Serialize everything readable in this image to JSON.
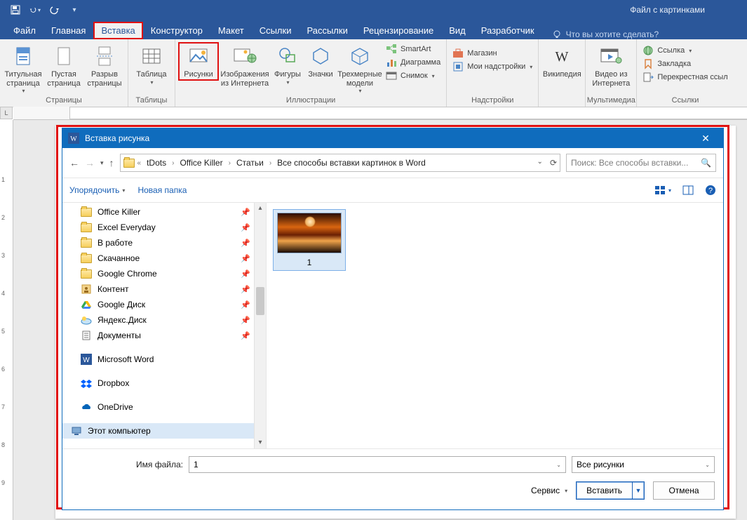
{
  "title": "Файл с картинками",
  "qat": {
    "save": "save",
    "undo": "undo",
    "redo": "redo"
  },
  "menu": {
    "tabs": [
      "Файл",
      "Главная",
      "Вставка",
      "Конструктор",
      "Макет",
      "Ссылки",
      "Рассылки",
      "Рецензирование",
      "Вид",
      "Разработчик"
    ],
    "active_index": 2,
    "tellme": "Что вы хотите сделать?"
  },
  "ribbon": {
    "pages": {
      "label": "Страницы",
      "cover": "Титульная страница",
      "blank": "Пустая страница",
      "break": "Разрыв страницы"
    },
    "tables": {
      "label": "Таблицы",
      "table": "Таблица"
    },
    "illustr": {
      "label": "Иллюстрации",
      "pictures": "Рисунки",
      "online": "Изображения из Интернета",
      "shapes": "Фигуры",
      "icons": "Значки",
      "models": "Трехмерные модели",
      "smartart": "SmartArt",
      "chart": "Диаграмма",
      "screenshot": "Снимок"
    },
    "addins": {
      "label": "Надстройки",
      "store": "Магазин",
      "myaddins": "Мои надстройки"
    },
    "wiki": {
      "label": "Википедия"
    },
    "media": {
      "label": "Мультимедиа",
      "video": "Видео из Интернета"
    },
    "links": {
      "label": "Ссылки",
      "hyperlink": "Ссылка",
      "bookmark": "Закладка",
      "crossref": "Перекрестная ссыл"
    }
  },
  "dlg": {
    "title": "Вставка рисунка",
    "crumbs": [
      "tDots",
      "Office Killer",
      "Статьи",
      "Все способы вставки картинок в Word"
    ],
    "search_placeholder": "Поиск: Все способы вставки...",
    "organize": "Упорядочить",
    "newfolder": "Новая папка",
    "side": [
      "Office Killer",
      "Excel Everyday",
      "В работе",
      "Скачанное",
      "Google Chrome",
      "Контент",
      "Google Диск",
      "Яндекс.Диск",
      "Документы",
      "Microsoft Word",
      "Dropbox",
      "OneDrive",
      "Этот компьютер"
    ],
    "selected_side_index": 12,
    "file_name": "1",
    "filter": "Все рисунки",
    "filename_label": "Имя файла:",
    "tools": "Сервис",
    "insert": "Вставить",
    "cancel": "Отмена",
    "thumb_label": "1"
  }
}
